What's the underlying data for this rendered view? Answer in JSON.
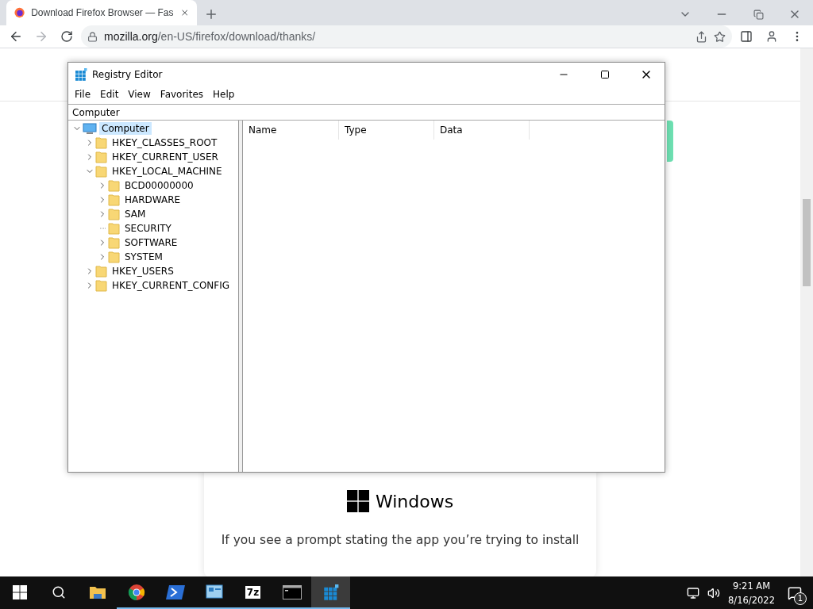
{
  "browser": {
    "tab": {
      "title": "Download Firefox Browser — Fas",
      "selected": true
    },
    "address": {
      "host": "mozilla.org",
      "path": "/en-US/firefox/download/thanks/"
    },
    "page": {
      "card": {
        "logo_text": "Windows",
        "body": "If you see a prompt stating the app you’re trying to install"
      }
    }
  },
  "registry_editor": {
    "title": "Registry Editor",
    "menu": [
      "File",
      "Edit",
      "View",
      "Favorites",
      "Help"
    ],
    "address": "Computer",
    "tree": [
      {
        "label": "Computer",
        "kind": "computer",
        "selected": true,
        "expanded": true,
        "expandable": true,
        "children": [
          {
            "label": "HKEY_CLASSES_ROOT",
            "kind": "folder",
            "selected": false,
            "expanded": false,
            "expandable": true
          },
          {
            "label": "HKEY_CURRENT_USER",
            "kind": "folder",
            "selected": false,
            "expanded": false,
            "expandable": true
          },
          {
            "label": "HKEY_LOCAL_MACHINE",
            "kind": "folder",
            "selected": false,
            "expanded": true,
            "expandable": true,
            "children": [
              {
                "label": "BCD00000000",
                "kind": "folder",
                "selected": false,
                "expanded": false,
                "expandable": true
              },
              {
                "label": "HARDWARE",
                "kind": "folder",
                "selected": false,
                "expanded": false,
                "expandable": true
              },
              {
                "label": "SAM",
                "kind": "folder",
                "selected": false,
                "expanded": false,
                "expandable": true
              },
              {
                "label": "SECURITY",
                "kind": "folder",
                "selected": false,
                "expandable": false
              },
              {
                "label": "SOFTWARE",
                "kind": "folder",
                "selected": false,
                "expanded": false,
                "expandable": true
              },
              {
                "label": "SYSTEM",
                "kind": "folder",
                "selected": false,
                "expanded": false,
                "expandable": true
              }
            ]
          },
          {
            "label": "HKEY_USERS",
            "kind": "folder",
            "selected": false,
            "expanded": false,
            "expandable": true
          },
          {
            "label": "HKEY_CURRENT_CONFIG",
            "kind": "folder",
            "selected": false,
            "expanded": false,
            "expandable": true
          }
        ]
      }
    ],
    "columns": [
      "Name",
      "Type",
      "Data"
    ]
  },
  "taskbar": {
    "items": [
      {
        "kind": "start",
        "running": false,
        "active": false
      },
      {
        "kind": "search",
        "running": false,
        "active": false
      },
      {
        "kind": "explorer",
        "running": false,
        "active": false
      },
      {
        "kind": "chrome",
        "running": true,
        "active": false
      },
      {
        "kind": "powershell",
        "running": true,
        "active": false
      },
      {
        "kind": "app",
        "running": true,
        "active": false
      },
      {
        "kind": "sevenzip",
        "label": "7z",
        "running": true,
        "active": false
      },
      {
        "kind": "terminal",
        "running": true,
        "active": false
      },
      {
        "kind": "registry",
        "running": true,
        "active": true
      }
    ],
    "time": "9:21 AM",
    "date": "8/16/2022",
    "notifications": "1"
  }
}
